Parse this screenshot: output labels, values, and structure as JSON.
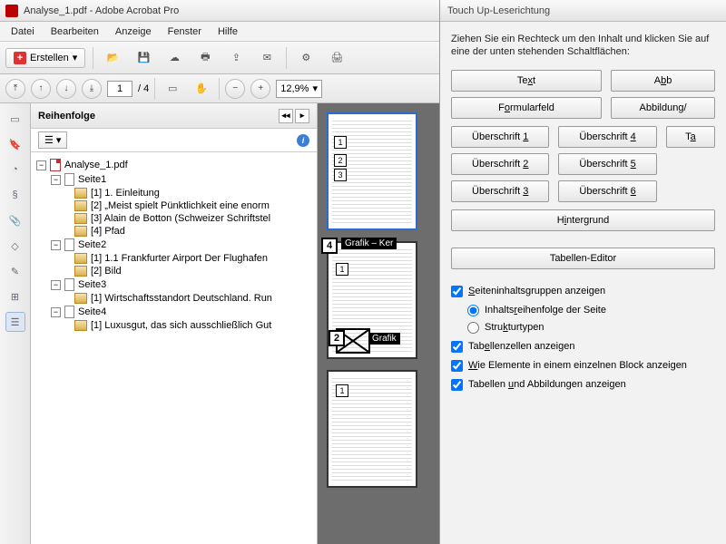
{
  "window": {
    "title": "Analyse_1.pdf - Adobe Acrobat Pro"
  },
  "menu": {
    "items": [
      "Datei",
      "Bearbeiten",
      "Anzeige",
      "Fenster",
      "Hilfe"
    ]
  },
  "toolbar": {
    "create": "Erstellen"
  },
  "nav": {
    "page": "1",
    "total": "/  4",
    "zoom": "12,9%"
  },
  "panel": {
    "title": "Reihenfolge"
  },
  "tree": {
    "root": "Analyse_1.pdf",
    "pages": [
      {
        "label": "Seite1",
        "items": [
          "[1]  1. Einleitung",
          "[2]  „Meist spielt Pünktlichkeit eine enorm",
          "[3]  Alain de Botton (Schweizer Schriftstel",
          "[4]  Pfad"
        ]
      },
      {
        "label": "Seite2",
        "items": [
          "[1]  1.1 Frankfurter Airport Der Flughafen",
          "[2]  Bild"
        ]
      },
      {
        "label": "Seite3",
        "items": [
          "[1]  Wirtschaftsstandort Deutschland. Run"
        ]
      },
      {
        "label": "Seite4",
        "items": [
          "[1]  Luxusgut, das sich ausschließlich Gut"
        ]
      }
    ]
  },
  "thumb_labels": {
    "grafik_ker": "Grafik – Ker",
    "grafik": "Grafik"
  },
  "dialog": {
    "title": "Touch Up-Leserichtung",
    "instr": "Ziehen Sie ein Rechteck um den Inhalt und klicken Sie auf eine der unten stehenden Schaltflächen:",
    "buttons": {
      "text": "Text",
      "abb": "Abb",
      "form": "Formularfeld",
      "abbildung": "Abbildung/",
      "h1": "Überschrift 1",
      "h2": "Überschrift 2",
      "h3": "Überschrift 3",
      "h4": "Überschrift 4",
      "h5": "Überschrift 5",
      "h6": "Überschrift 6",
      "ta": "Ta",
      "hinter": "Hintergrund",
      "tbl_editor": "Tabellen-Editor"
    },
    "checks": {
      "c1": "Seiteninhaltsgruppen anzeigen",
      "r1": "Inhaltsreihenfolge der Seite",
      "r2": "Strukturtypen",
      "c2": "Tabellenzellen anzeigen",
      "c3": "Wie Elemente in einem einzelnen Block anzeigen",
      "c4": "Tabellen und Abbildungen anzeigen"
    }
  }
}
